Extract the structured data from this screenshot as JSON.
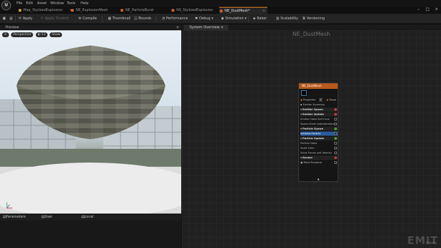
{
  "menubar": {
    "logo": "U",
    "items": [
      "File",
      "Edit",
      "Asset",
      "Window",
      "Tools",
      "Help"
    ]
  },
  "tabs": [
    {
      "label": "Map_StylizedExplosion",
      "color": "#c8a040"
    },
    {
      "label": "NE_ExplosionMesh",
      "color": "#d06020"
    },
    {
      "label": "NE_ParticleBurst",
      "color": "#d06020"
    },
    {
      "label": "NS_StylizedExplosion",
      "color": "#d06020"
    },
    {
      "label": "NE_DustMesh*",
      "color": "#d06020",
      "active": true
    }
  ],
  "toolbar": {
    "items": [
      {
        "label": "Apply",
        "icon": "apply-icon"
      },
      {
        "label": "Apply Scratch",
        "icon": "apply-scratch-icon",
        "disabled": true
      },
      {
        "label": "Compile",
        "icon": "compile-icon"
      },
      {
        "label": "Thumbnail",
        "icon": "thumbnail-icon"
      },
      {
        "label": "Bounds",
        "icon": "bounds-icon"
      },
      {
        "label": "Performance",
        "icon": "performance-icon"
      },
      {
        "label": "Debug",
        "icon": "debug-icon"
      },
      {
        "label": "Simulation",
        "icon": "simulation-icon"
      },
      {
        "label": "Baker",
        "icon": "baker-icon"
      },
      {
        "label": "Scalability",
        "icon": "scalability-icon"
      },
      {
        "label": "Versioning",
        "icon": "versioning-icon"
      }
    ]
  },
  "preview": {
    "title": "Preview",
    "view_mode": "Perspective",
    "lit_value": "13",
    "show_label": "Show"
  },
  "bottom_tabs": [
    "Parameters",
    "User Parameters",
    "Local Modules"
  ],
  "graph": {
    "tab_label": "System Overview",
    "title": "NE_DustMesh"
  },
  "emitter": {
    "name": "NE_DustMesh",
    "properties_label": "Properties",
    "stage_label": "Stage",
    "rows": [
      {
        "label": "Emitter Summary",
        "type": "item"
      },
      {
        "label": "Emitter Spawn",
        "type": "section",
        "dot": "#b04040"
      },
      {
        "label": "Emitter Update",
        "type": "section",
        "dot": "#b04040"
      },
      {
        "label": "Emitter State  Self  Once",
        "type": "item",
        "check": true
      },
      {
        "label": "Spawn Burst Instantaneous",
        "type": "item",
        "check": true
      },
      {
        "label": "Particle Spawn",
        "type": "section",
        "dot": "#4a9a3a"
      },
      {
        "label": "Initialize Particle",
        "type": "selected",
        "check": true
      },
      {
        "label": "Particle Update",
        "type": "section",
        "dot": "#4a9a3a"
      },
      {
        "label": "Particle State",
        "type": "item",
        "check": true
      },
      {
        "label": "Scale Color",
        "type": "item",
        "check": true
      },
      {
        "label": "Solve Forces and Velocity",
        "type": "item",
        "check": true
      },
      {
        "label": "Render",
        "type": "section",
        "dot": "#b04040"
      },
      {
        "label": "Mesh Renderer",
        "type": "item",
        "check": true
      }
    ],
    "footer": "▲"
  },
  "watermark": {
    "text": "EMIT",
    "sub": "Udemy"
  }
}
